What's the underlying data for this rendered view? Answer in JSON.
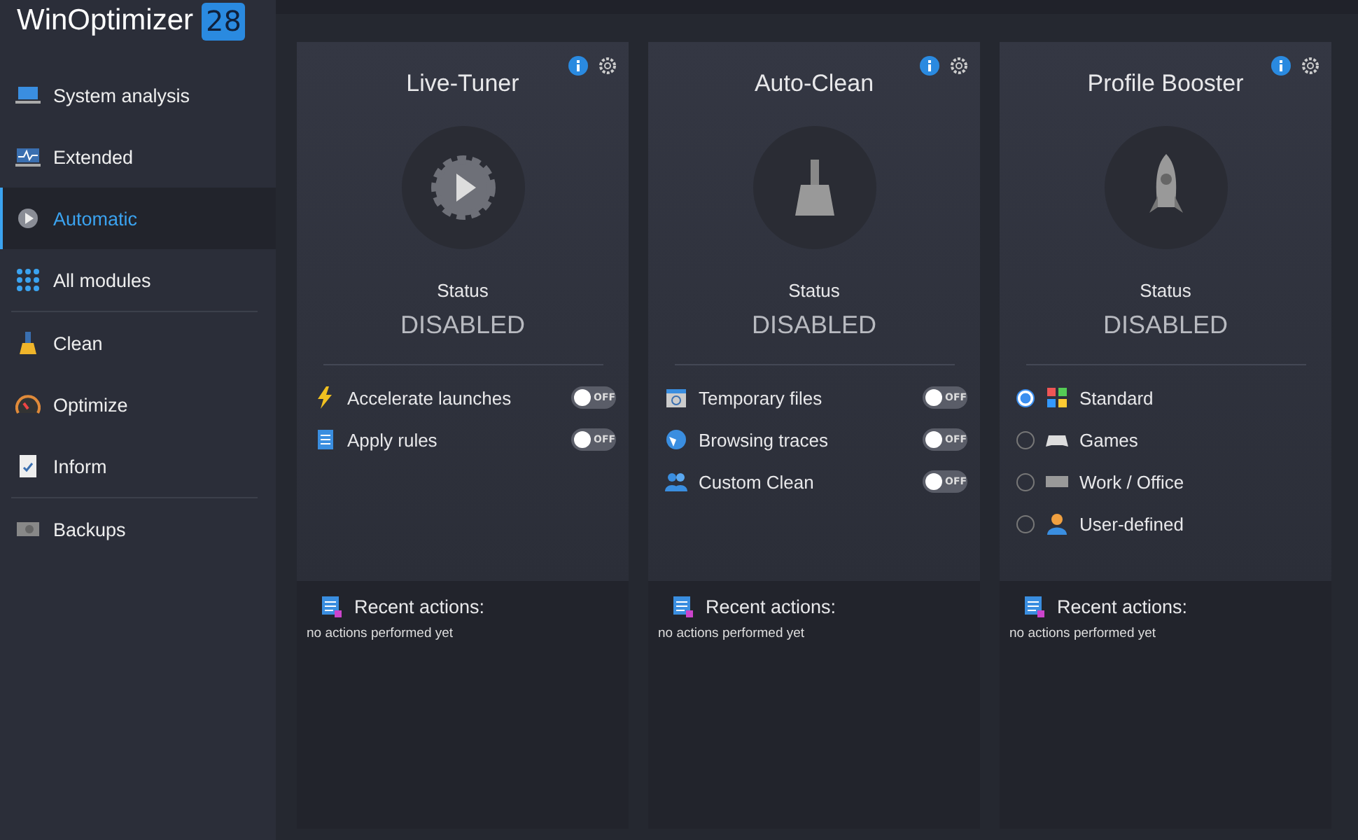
{
  "app": {
    "name": "WinOptimizer",
    "version": "28"
  },
  "sidebar": {
    "items": [
      {
        "label": "System analysis",
        "selected": false
      },
      {
        "label": "Extended",
        "selected": false
      },
      {
        "label": "Automatic",
        "selected": true
      },
      {
        "label": "All modules",
        "selected": false
      },
      {
        "label": "Clean",
        "selected": false
      },
      {
        "label": "Optimize",
        "selected": false
      },
      {
        "label": "Inform",
        "selected": false
      },
      {
        "label": "Backups",
        "selected": false
      }
    ]
  },
  "cards": [
    {
      "title": "Live-Tuner",
      "status_label": "Status",
      "status": "DISABLED",
      "options": [
        {
          "kind": "toggle",
          "label": "Accelerate launches",
          "on": false,
          "switch_text": "OFF"
        },
        {
          "kind": "toggle",
          "label": "Apply rules",
          "on": false,
          "switch_text": "OFF"
        }
      ],
      "recent_title": "Recent actions:",
      "recent_text": "no actions performed yet"
    },
    {
      "title": "Auto-Clean",
      "status_label": "Status",
      "status": "DISABLED",
      "options": [
        {
          "kind": "toggle",
          "label": "Temporary files",
          "on": false,
          "switch_text": "OFF"
        },
        {
          "kind": "toggle",
          "label": "Browsing traces",
          "on": false,
          "switch_text": "OFF"
        },
        {
          "kind": "toggle",
          "label": "Custom Clean",
          "on": false,
          "switch_text": "OFF"
        }
      ],
      "recent_title": "Recent actions:",
      "recent_text": "no actions performed yet"
    },
    {
      "title": "Profile Booster",
      "status_label": "Status",
      "status": "DISABLED",
      "options": [
        {
          "kind": "radio",
          "label": "Standard",
          "selected": true
        },
        {
          "kind": "radio",
          "label": "Games",
          "selected": false
        },
        {
          "kind": "radio",
          "label": "Work / Office",
          "selected": false
        },
        {
          "kind": "radio",
          "label": "User-defined",
          "selected": false
        }
      ],
      "recent_title": "Recent actions:",
      "recent_text": "no actions performed yet"
    }
  ]
}
